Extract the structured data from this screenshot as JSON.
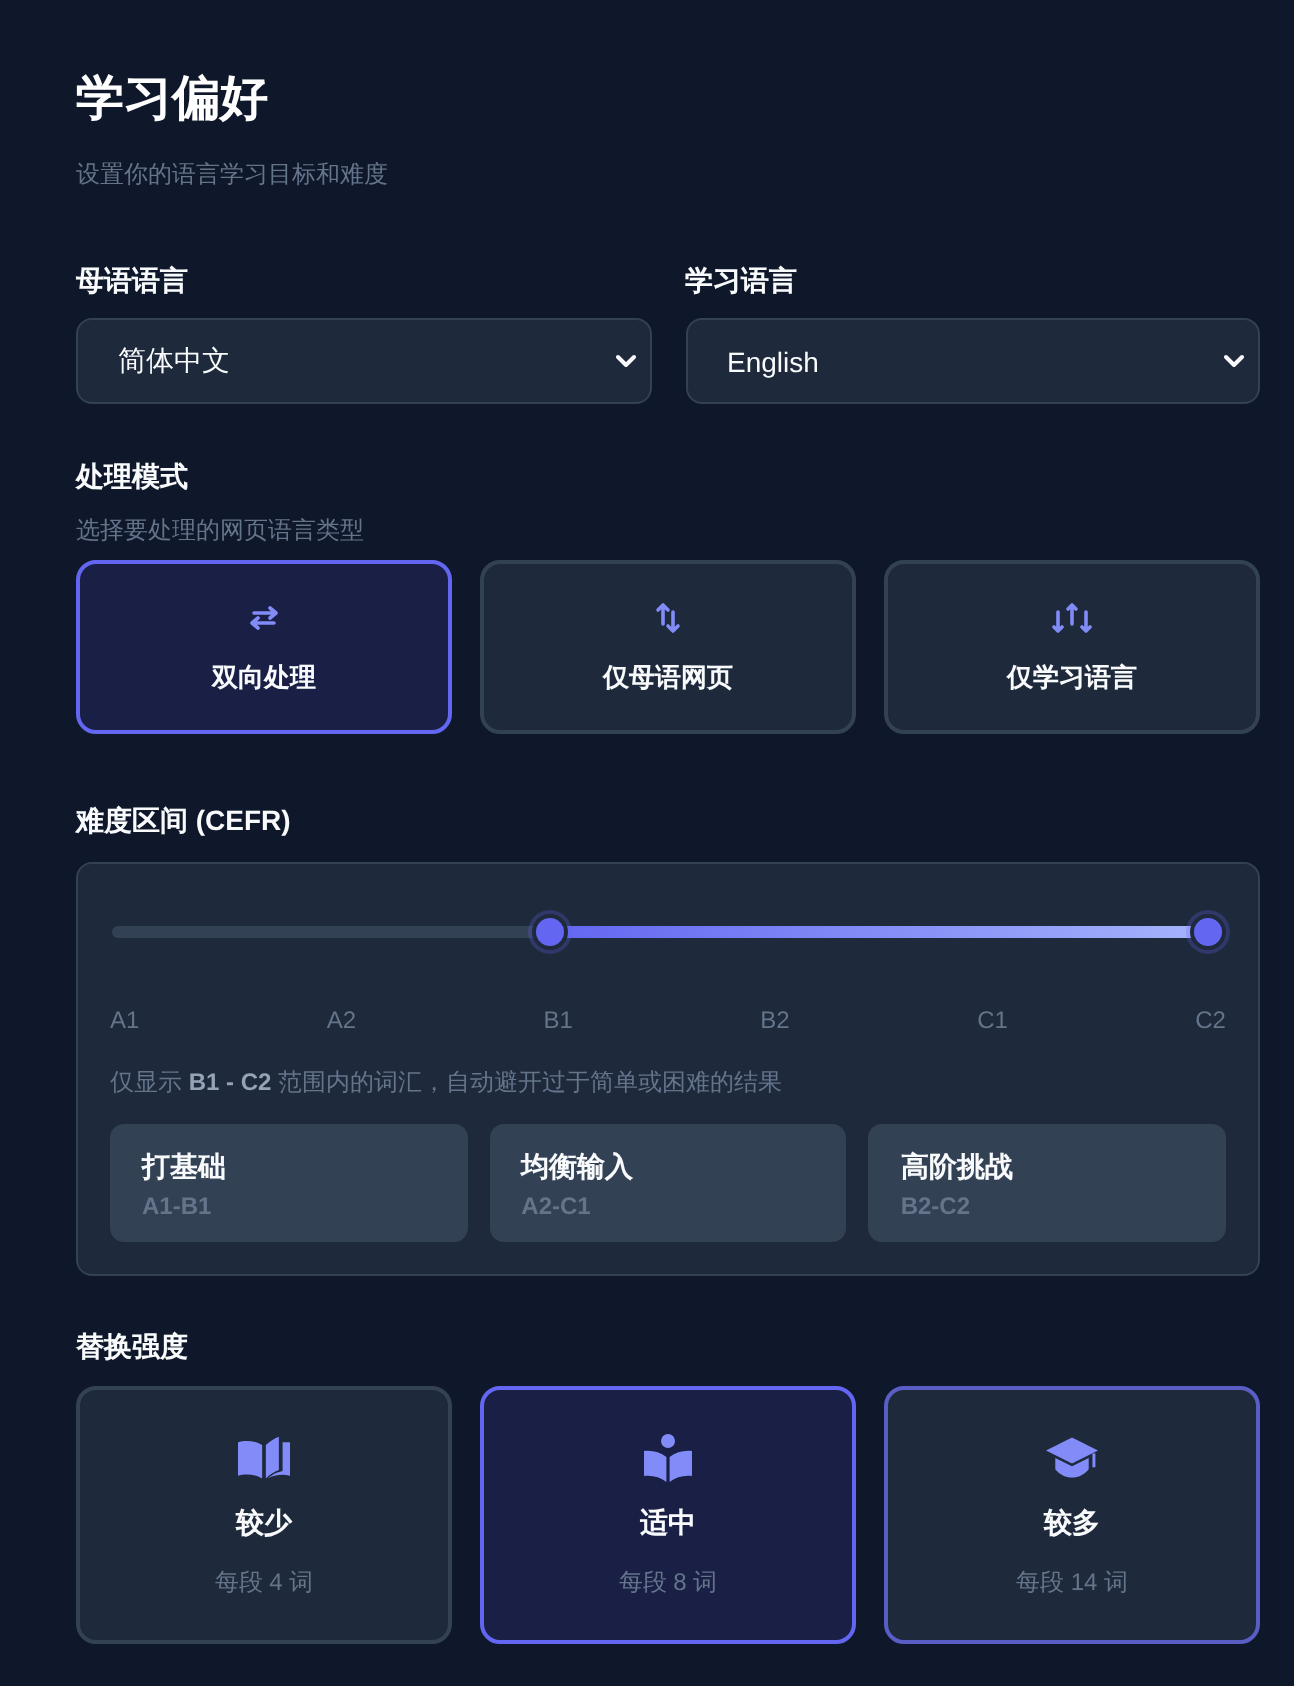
{
  "page": {
    "title": "学习偏好",
    "subtitle": "设置你的语言学习目标和难度"
  },
  "languages": [
    {
      "label": "母语语言",
      "value": "简体中文"
    },
    {
      "label": "学习语言",
      "value": "English"
    }
  ],
  "processing_mode": {
    "label": "处理模式",
    "hint": "选择要处理的网页语言类型",
    "options": [
      {
        "kind": "bidirectional",
        "label": "双向处理",
        "selected": true
      },
      {
        "kind": "native_only",
        "label": "仅母语网页",
        "selected": false
      },
      {
        "kind": "learning_only",
        "label": "仅学习语言",
        "selected": false
      }
    ]
  },
  "difficulty": {
    "label": "难度区间 (CEFR)",
    "ticks": [
      {
        "label": "A1",
        "selected": false
      },
      {
        "label": "A2",
        "selected": false
      },
      {
        "label": "B1",
        "selected": true
      },
      {
        "label": "B2",
        "selected": false
      },
      {
        "label": "C1",
        "selected": false
      },
      {
        "label": "C2",
        "selected": true
      }
    ],
    "hint": "仅显示 **B1 - C2** 范围内的词汇，自动避开过于简单或困难的结果",
    "presets": [
      {
        "title": "打基础",
        "range": "A1-B1",
        "selected": false
      },
      {
        "title": "均衡输入",
        "range": "A2-C1",
        "selected": false
      },
      {
        "title": "高阶挑战",
        "range": "B2-C2",
        "selected": false
      }
    ]
  },
  "intensity": {
    "label": "替换强度",
    "options": [
      {
        "kind": "few",
        "label": "较少",
        "detail": "每段 4 词",
        "selected": false,
        "hovered": false
      },
      {
        "kind": "medium",
        "label": "适中",
        "detail": "每段 8 词",
        "selected": true,
        "hovered": false
      },
      {
        "kind": "many",
        "label": "较多",
        "detail": "每段 14 词",
        "selected": false,
        "hovered": true
      }
    ]
  }
}
